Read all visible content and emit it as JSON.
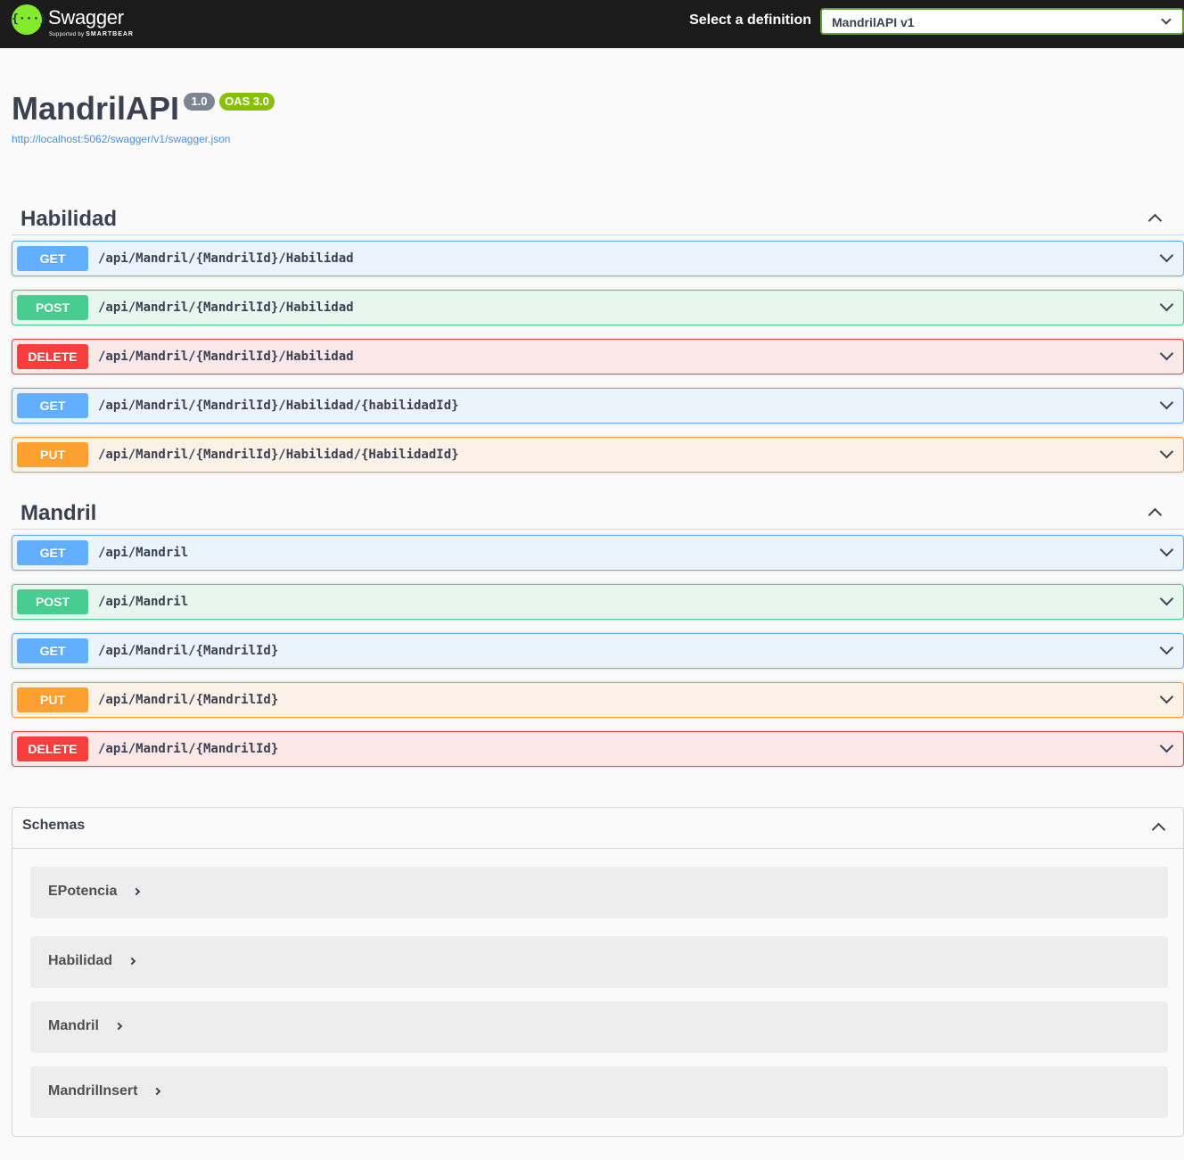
{
  "topbar": {
    "brand": "Swagger",
    "brand_sub_prefix": "Supported by",
    "brand_sub_company": "SMARTBEAR",
    "logo_glyph": "{···}",
    "definition_label": "Select a definition",
    "definition_value": "MandrilAPI v1"
  },
  "info": {
    "title": "MandrilAPI",
    "version": "1.0",
    "oas": "OAS 3.0",
    "url": "http://localhost:5062/swagger/v1/swagger.json"
  },
  "tags": [
    {
      "name": "Habilidad",
      "operations": [
        {
          "method": "GET",
          "path": "/api/Mandril/{MandrilId}/Habilidad"
        },
        {
          "method": "POST",
          "path": "/api/Mandril/{MandrilId}/Habilidad"
        },
        {
          "method": "DELETE",
          "path": "/api/Mandril/{MandrilId}/Habilidad"
        },
        {
          "method": "GET",
          "path": "/api/Mandril/{MandrilId}/Habilidad/{habilidadId}"
        },
        {
          "method": "PUT",
          "path": "/api/Mandril/{MandrilId}/Habilidad/{HabilidadId}"
        }
      ]
    },
    {
      "name": "Mandril",
      "operations": [
        {
          "method": "GET",
          "path": "/api/Mandril"
        },
        {
          "method": "POST",
          "path": "/api/Mandril"
        },
        {
          "method": "GET",
          "path": "/api/Mandril/{MandrilId}"
        },
        {
          "method": "PUT",
          "path": "/api/Mandril/{MandrilId}"
        },
        {
          "method": "DELETE",
          "path": "/api/Mandril/{MandrilId}"
        }
      ]
    }
  ],
  "schemas": {
    "title": "Schemas",
    "models": [
      "EPotencia",
      "Habilidad",
      "Mandril",
      "MandrilInsert"
    ]
  },
  "colors": {
    "get": "#61affe",
    "post": "#49cc90",
    "delete": "#f93e3e",
    "put": "#fca130",
    "logo": "#85ea2d",
    "topbar": "#1b1b1b"
  }
}
